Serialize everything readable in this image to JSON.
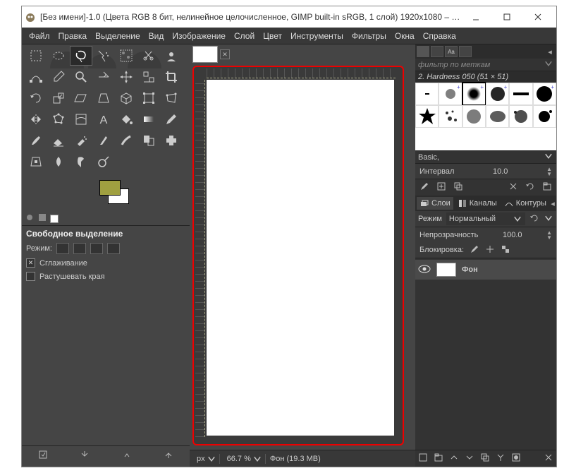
{
  "window": {
    "title": "[Без имени]-1.0 (Цвета RGB 8 бит, нелинейное целочисленное, GIMP built-in sRGB, 1 слой) 1920x1080 – G..."
  },
  "menu": [
    "Файл",
    "Правка",
    "Выделение",
    "Вид",
    "Изображение",
    "Слой",
    "Цвет",
    "Инструменты",
    "Фильтры",
    "Окна",
    "Справка"
  ],
  "tool_options": {
    "title": "Свободное выделение",
    "mode_label": "Режим:",
    "antialias": "Сглаживание",
    "feather": "Растушевать края"
  },
  "status": {
    "unit": "px",
    "zoom": "66.7 %",
    "layer": "Фон (19.3 MB)"
  },
  "brushes": {
    "filter_placeholder": "фильтр по меткам",
    "current": "2. Hardness 050 (51 × 51)",
    "preset": "Basic,",
    "spacing_label": "Интервал",
    "spacing_value": "10.0"
  },
  "layers": {
    "tabs": {
      "layers": "Слои",
      "channels": "Каналы",
      "paths": "Контуры"
    },
    "mode_label": "Режим",
    "mode_value": "Нормальный",
    "opacity_label": "Непрозрачность",
    "opacity_value": "100.0",
    "lock_label": "Блокировка:",
    "layer_name": "Фон"
  }
}
